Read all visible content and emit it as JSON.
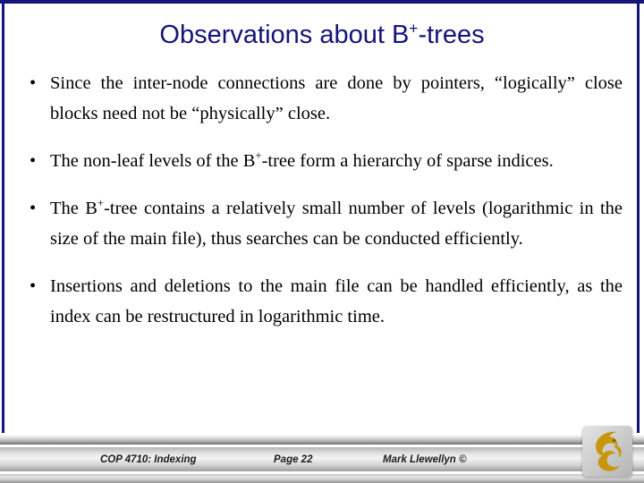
{
  "slide": {
    "title_prefix": "Observations about B",
    "title_superscript": "+",
    "title_suffix": "-trees",
    "title_color": "#14147a",
    "border_color": "#14147a",
    "background_color": "#ffffff",
    "body_text_color": "#000000"
  },
  "bullets": [
    {
      "marker": "•",
      "segments": [
        {
          "text": "Since the inter-node connections are done by pointers, “logically” close blocks need not be “physically” close."
        }
      ]
    },
    {
      "marker": "•",
      "segments": [
        {
          "text": "The non-leaf levels of the B"
        },
        {
          "sup": "+"
        },
        {
          "text": "-tree form a hierarchy of sparse indices."
        }
      ]
    },
    {
      "marker": "•",
      "segments": [
        {
          "text": "The B"
        },
        {
          "sup": "+"
        },
        {
          "text": "-tree contains a relatively small number of levels (logarithmic in the size of the main file), thus searches can be conducted efficiently."
        }
      ]
    },
    {
      "marker": "•",
      "segments": [
        {
          "text": "Insertions and deletions to the main file can be handled efficiently, as the index can be restructured in logarithmic time."
        }
      ]
    }
  ],
  "footer": {
    "course": "COP 4710: Indexing",
    "page": "Page 22",
    "author": "Mark Llewellyn ©",
    "logo_color": "#c8960c",
    "logo_name": "ucf-pegasus-logo"
  }
}
